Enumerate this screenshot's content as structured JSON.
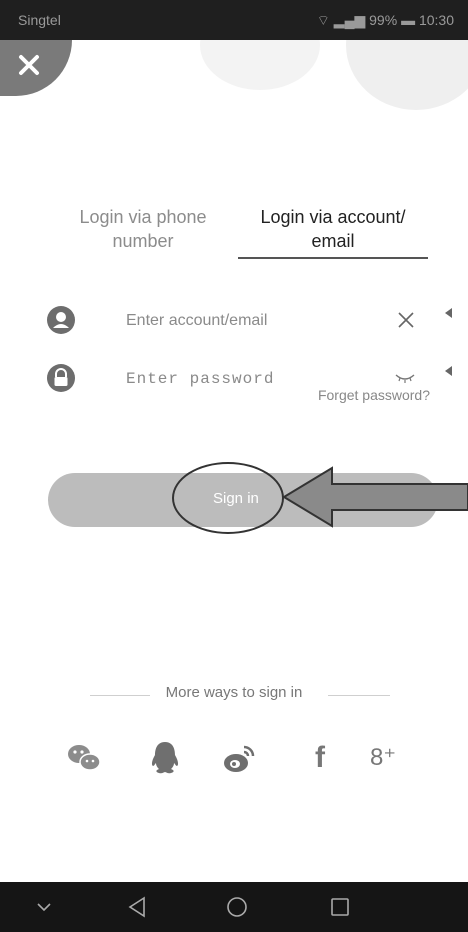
{
  "status_bar": {
    "carrier": "Singtel",
    "battery": "99%",
    "time": "10:30"
  },
  "tabs": {
    "phone": "Login via phone number",
    "account": "Login via account/ email"
  },
  "fields": {
    "account_placeholder": "Enter account/email",
    "password_placeholder": "Enter password"
  },
  "forgot_password": "Forget password?",
  "sign_in_label": "Sign in",
  "more_ways_label": "More ways to sign in",
  "social": {
    "facebook_glyph": "f",
    "gplus_glyph": "8⁺"
  },
  "icons": {
    "close": "close-icon",
    "user": "user-icon",
    "lock": "lock-icon",
    "clear": "clear-icon",
    "eye": "eye-closed-icon",
    "wechat": "wechat-icon",
    "qq": "qq-icon",
    "weibo": "weibo-icon",
    "facebook": "facebook-icon",
    "gplus": "google-plus-icon",
    "nav_down": "chevron-down-icon",
    "nav_back": "back-icon",
    "nav_home": "home-icon",
    "nav_recent": "recent-apps-icon"
  },
  "colors": {
    "signin_bar": "#bcbcbc",
    "icon_gray": "#6d6d6d",
    "status_bg": "#1f1f1f"
  }
}
